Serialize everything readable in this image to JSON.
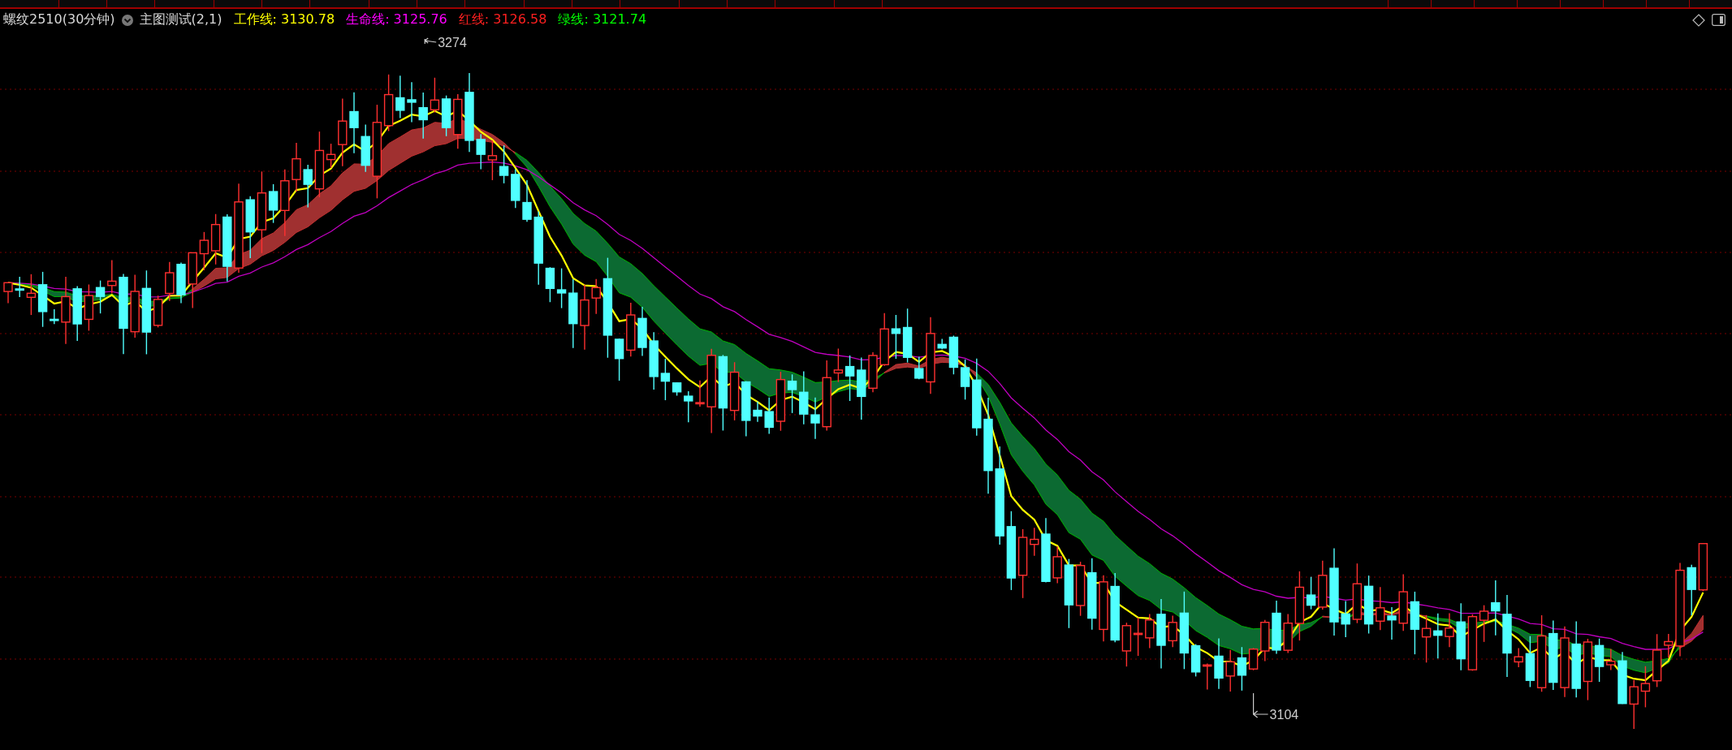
{
  "header": {
    "symbol": "螺纹2510(30分钟)",
    "indicator": "主图测试(2,1)",
    "lines": [
      {
        "label": "工作线:",
        "value": "3130.78",
        "color": "#ffff00"
      },
      {
        "label": "生命线:",
        "value": "3125.76",
        "color": "#ff00ff"
      },
      {
        "label": "红线:",
        "value": "3126.58",
        "color": "#ff2020"
      },
      {
        "label": "绿线:",
        "value": "3121.74",
        "color": "#00ff00"
      }
    ]
  },
  "chart": {
    "high_mark": "3274",
    "low_mark": "3104"
  }
}
